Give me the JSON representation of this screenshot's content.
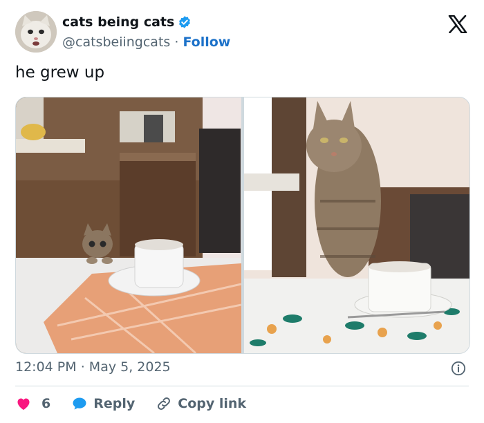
{
  "author": {
    "display_name": "cats being cats",
    "handle": "@catsbeiingcats",
    "follow_label": "Follow",
    "separator": "·"
  },
  "post": {
    "text": "he grew up",
    "time": "12:04 PM",
    "date": "May 5, 2025"
  },
  "actions": {
    "likes": "6",
    "reply_label": "Reply",
    "copy_link_label": "Copy link"
  },
  "colors": {
    "link": "#1d72c9",
    "like": "#f91880",
    "reply": "#1d9bf0",
    "muted": "#536471",
    "border": "#cfd9de"
  },
  "icons": [
    "x-logo-icon",
    "verified-badge-icon",
    "info-icon",
    "heart-icon",
    "reply-bubble-icon",
    "link-icon"
  ]
}
